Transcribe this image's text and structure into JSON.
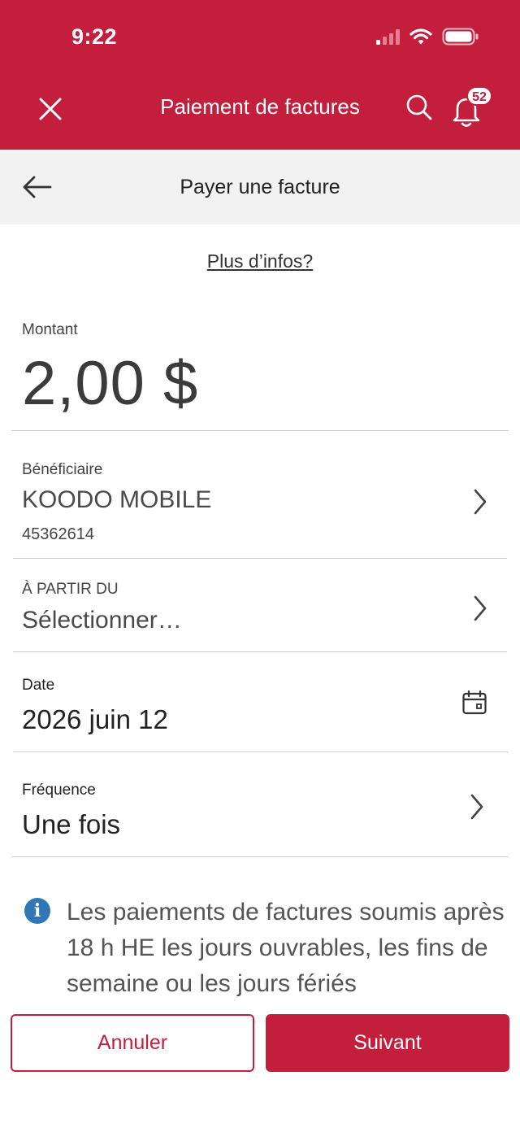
{
  "status_bar": {
    "time": "9:22"
  },
  "header": {
    "title": "Paiement de factures",
    "notification_count": "52"
  },
  "subheader": {
    "title": "Payer une facture"
  },
  "more_info_link": "Plus d’infos?",
  "form": {
    "amount": {
      "label": "Montant",
      "value": "2,00 $"
    },
    "payee": {
      "label": "Bénéficiaire",
      "name": "KOODO MOBILE",
      "number": "45362614"
    },
    "from_account": {
      "label": "À PARTIR DU",
      "value": "Sélectionner…"
    },
    "date": {
      "label": "Date",
      "value": "2026 juin 12"
    },
    "frequency": {
      "label": "Fréquence",
      "value": "Une fois"
    }
  },
  "info_message": "Les paiements de factures soumis après 18 h HE les jours ouvrables, les fins de semaine ou les jours fériés",
  "buttons": {
    "cancel": "Annuler",
    "next": "Suivant"
  },
  "colors": {
    "brand": "#c41e3d",
    "info": "#2f78b5"
  },
  "icons": [
    "close-icon",
    "search-icon",
    "bell-icon",
    "back-arrow-icon",
    "chevron-right-icon",
    "calendar-icon",
    "info-icon",
    "wifi-icon",
    "battery-icon",
    "signal-icon"
  ]
}
